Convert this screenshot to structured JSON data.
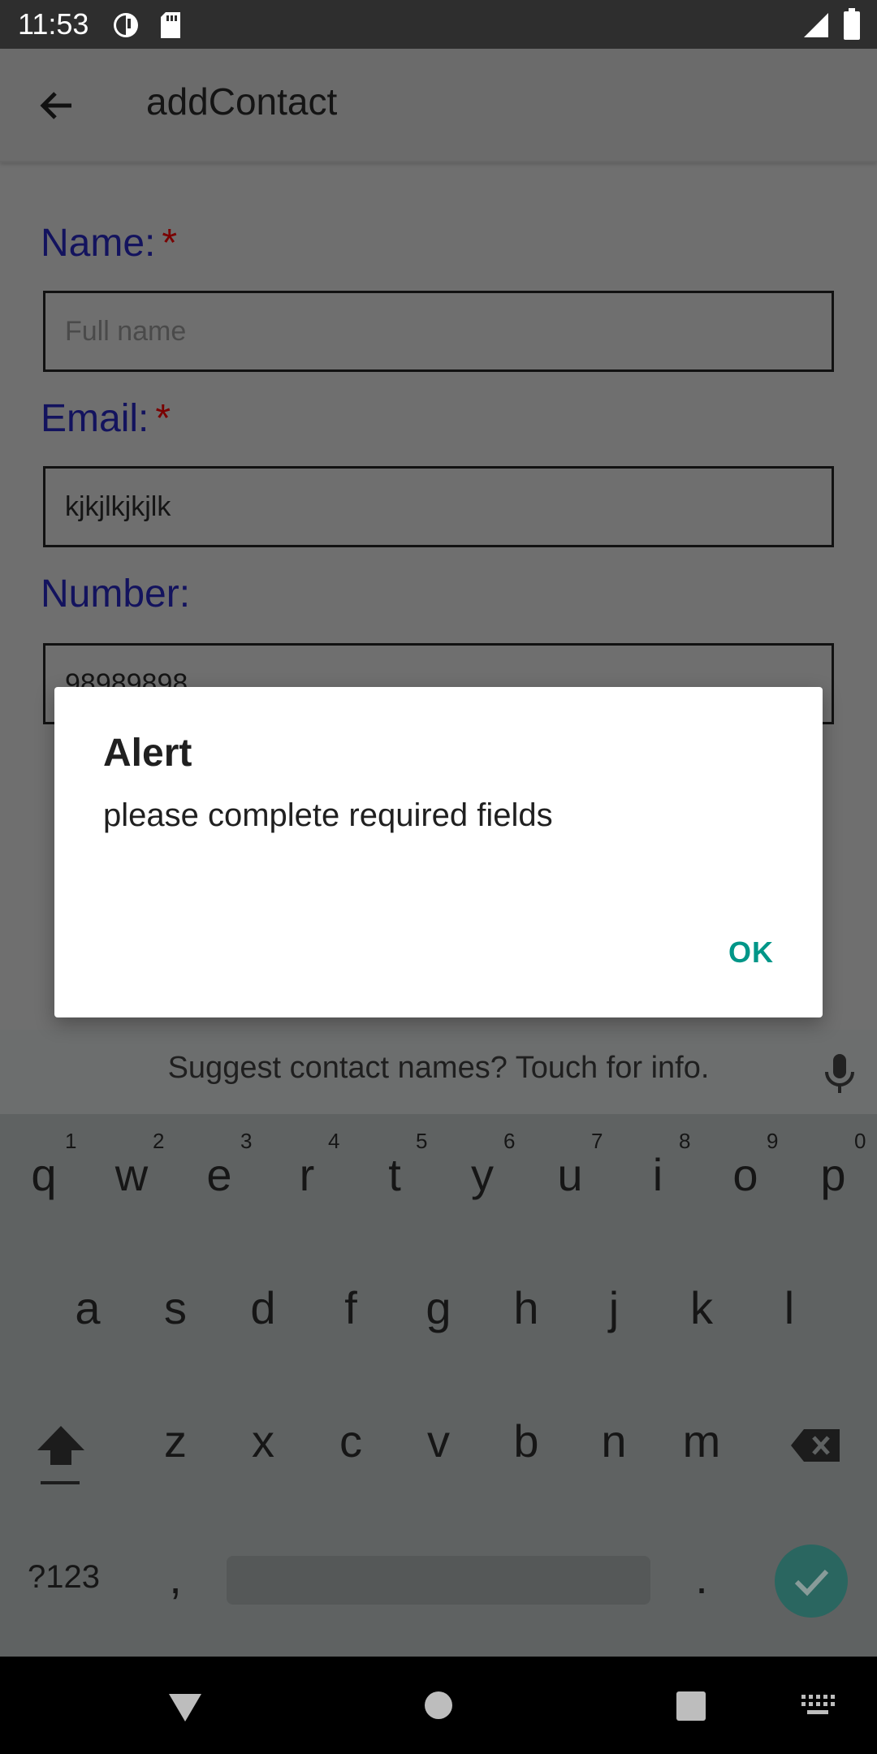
{
  "status_bar": {
    "time": "11:53",
    "icons": [
      "data-saver-icon",
      "sd-card-icon",
      "signal-icon",
      "battery-icon"
    ]
  },
  "app": {
    "title": "addContact",
    "back_icon": "arrow-back-icon",
    "fields": [
      {
        "label": "Name:",
        "required_mark": "*",
        "placeholder": "Full name",
        "value": ""
      },
      {
        "label": "Email:",
        "required_mark": "*",
        "placeholder": "",
        "value": "kjkjlkjkjlk"
      },
      {
        "label": "Number:",
        "required_mark": "",
        "placeholder": "",
        "value": "98989898"
      }
    ]
  },
  "dialog": {
    "title": "Alert",
    "message": "please complete required fields",
    "ok_label": "OK",
    "ok_color": "#009688"
  },
  "keyboard": {
    "suggestion": "Suggest contact names? Touch for info.",
    "row1": [
      "q",
      "w",
      "e",
      "r",
      "t",
      "y",
      "u",
      "i",
      "o",
      "p"
    ],
    "row1_hints": [
      "1",
      "2",
      "3",
      "4",
      "5",
      "6",
      "7",
      "8",
      "9",
      "0"
    ],
    "row2": [
      "a",
      "s",
      "d",
      "f",
      "g",
      "h",
      "j",
      "k",
      "l"
    ],
    "row3": [
      "z",
      "x",
      "c",
      "v",
      "b",
      "n",
      "m"
    ],
    "symbols_label": "?123",
    "comma": ",",
    "period": ".",
    "icons": [
      "mic-icon",
      "shift-icon",
      "backspace-icon",
      "enter-check-icon"
    ]
  },
  "nav_bar": {
    "icons": [
      "back-triangle-icon",
      "home-circle-icon",
      "recents-square-icon",
      "keyboard-switch-icon"
    ]
  }
}
